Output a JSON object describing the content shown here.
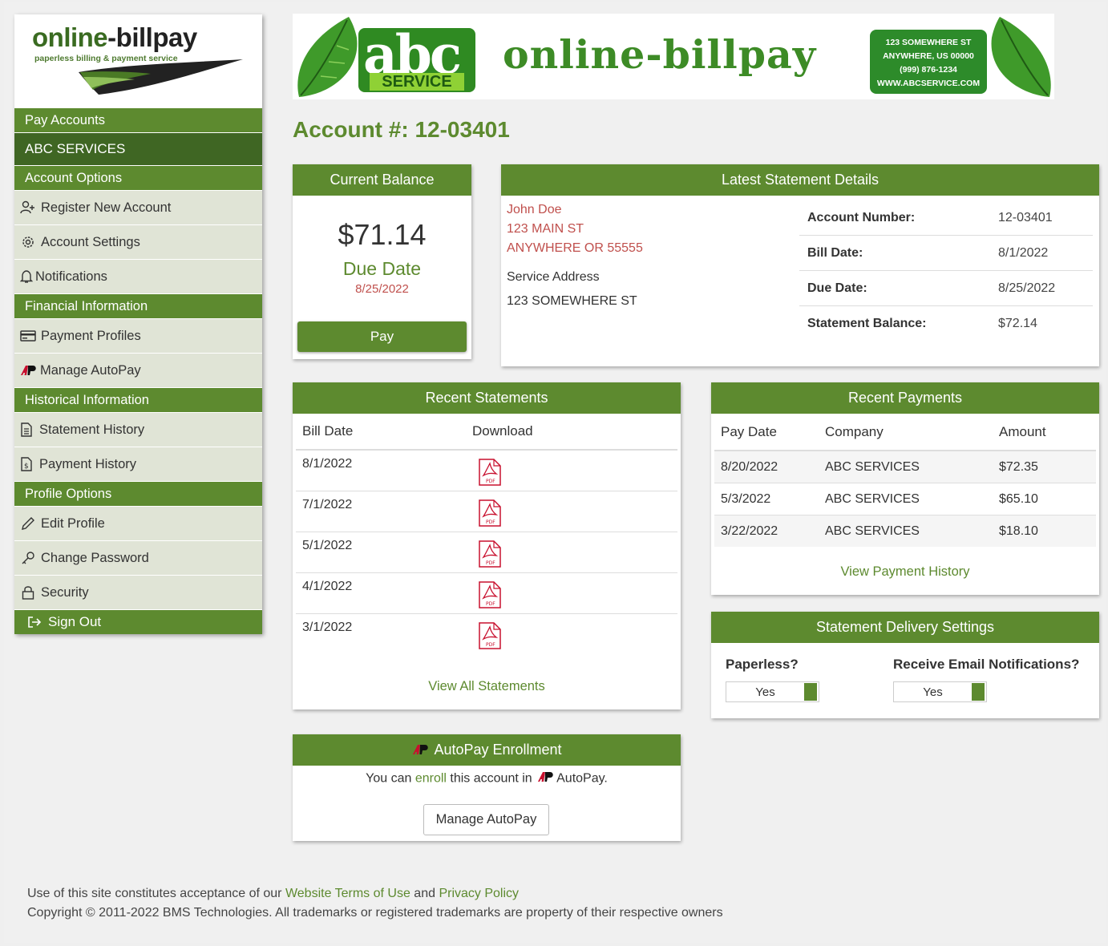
{
  "logo": {
    "word1": "online",
    "word2": "-",
    "word3": "billpay",
    "tagline": "paperless billing & payment service"
  },
  "sidebar": {
    "pay_accounts": "Pay Accounts",
    "account_name": "ABC SERVICES",
    "account_options": "Account Options",
    "register": "Register New Account",
    "account_settings": "Account Settings",
    "notifications": "Notifications",
    "financial": "Financial Information",
    "payment_profiles": "Payment Profiles",
    "manage_autopay": "Manage AutoPay",
    "historical": "Historical Information",
    "statement_history": "Statement History",
    "payment_history": "Payment History",
    "profile_options": "Profile Options",
    "edit_profile": "Edit Profile",
    "change_password": "Change Password",
    "security": "Security",
    "sign_out": "Sign Out"
  },
  "banner": {
    "abc": "abc",
    "service": "SERVICE",
    "title": "online-billpay",
    "addr1": "123 SOMEWHERE ST",
    "addr2": "ANYWHERE, US 00000",
    "addr3": "(999) 876-1234",
    "addr4": "WWW.ABCSERVICE.COM"
  },
  "account_title": "Account #: 12-03401",
  "balance": {
    "header": "Current Balance",
    "amount": "$71.14",
    "due_label": "Due Date",
    "due_date": "8/25/2022",
    "pay": "Pay"
  },
  "statement": {
    "header": "Latest Statement Details",
    "name": "John Doe",
    "street": "123 MAIN ST",
    "city": "ANYWHERE OR 55555",
    "service_label": "Service Address",
    "service_addr": "123 SOMEWHERE ST",
    "rows": [
      {
        "k": "Account Number:",
        "v": "12-03401"
      },
      {
        "k": "Bill Date:",
        "v": "8/1/2022"
      },
      {
        "k": "Due Date:",
        "v": "8/25/2022"
      },
      {
        "k": "Statement Balance:",
        "v": "$72.14"
      }
    ]
  },
  "recent_statements": {
    "header": "Recent Statements",
    "col1": "Bill Date",
    "col2": "Download",
    "rows": [
      "8/1/2022",
      "7/1/2022",
      "5/1/2022",
      "4/1/2022",
      "3/1/2022"
    ],
    "link": "View All Statements"
  },
  "recent_payments": {
    "header": "Recent Payments",
    "col1": "Pay Date",
    "col2": "Company",
    "col3": "Amount",
    "rows": [
      {
        "date": "8/20/2022",
        "company": "ABC SERVICES",
        "amount": "$72.35"
      },
      {
        "date": "5/3/2022",
        "company": "ABC SERVICES",
        "amount": "$65.10"
      },
      {
        "date": "3/22/2022",
        "company": "ABC SERVICES",
        "amount": "$18.10"
      }
    ],
    "link": "View Payment History"
  },
  "delivery": {
    "header": "Statement Delivery Settings",
    "paperless": "Paperless?",
    "email": "Receive Email Notifications?",
    "paperless_val": "Yes",
    "email_val": "Yes"
  },
  "autopay": {
    "header": "AutoPay Enrollment",
    "pre": "You can ",
    "enroll": "enroll",
    "mid": " this account in ",
    "brand": "AutoPay.",
    "button": "Manage AutoPay"
  },
  "footer": {
    "pre": "Use of this site constitutes acceptance of our ",
    "terms": "Website Terms of Use",
    "and": " and ",
    "privacy": "Privacy Policy",
    "copyright": "Copyright © 2011-2022 BMS Technologies. All trademarks or registered trademarks are property of their respective owners"
  },
  "colors": {
    "primary": "#5d8a2f",
    "dark": "#3f6623",
    "due": "#c0504d"
  }
}
